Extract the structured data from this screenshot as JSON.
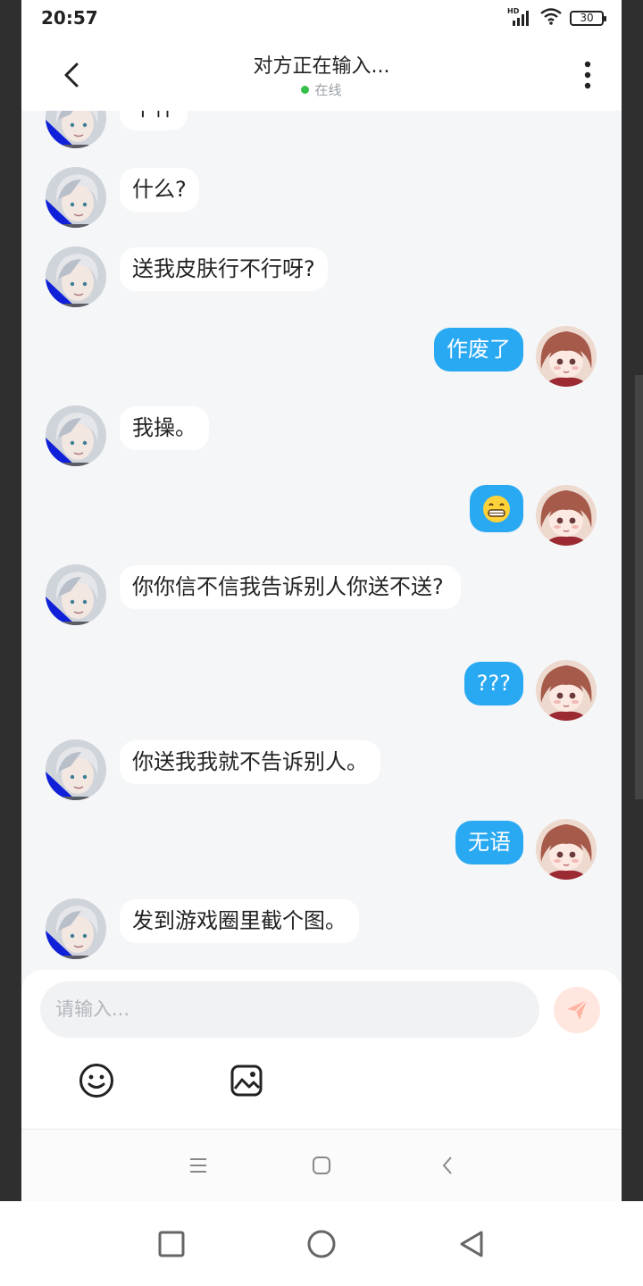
{
  "status_bar": {
    "time": "20:57",
    "network": "HD",
    "battery": "30"
  },
  "header": {
    "title": "对方正在输入...",
    "presence": "在线"
  },
  "messages": [
    {
      "side": "in",
      "text": "干什"
    },
    {
      "side": "in",
      "text": "什么?"
    },
    {
      "side": "in",
      "text": "送我皮肤行不行呀?"
    },
    {
      "side": "out",
      "text": "作废了"
    },
    {
      "side": "in",
      "text": "我操。"
    },
    {
      "side": "out",
      "text": "😁"
    },
    {
      "side": "in",
      "text": "你你信不信我告诉别人你送不送?"
    },
    {
      "side": "out",
      "text": "???"
    },
    {
      "side": "in",
      "text": "你送我我就不告诉别人。"
    },
    {
      "side": "out",
      "text": "无语"
    },
    {
      "side": "in",
      "text": "发到游戏圈里截个图。"
    }
  ],
  "composer": {
    "placeholder": "请输入..."
  },
  "colors": {
    "outgoing_bubble": "#2aa9f3",
    "incoming_bubble": "#ffffff",
    "online_dot": "#35c04a",
    "send_button": "#ffe6df"
  },
  "icons": [
    "back-icon",
    "more-vertical-icon",
    "send-icon",
    "smile-icon",
    "image-icon",
    "menu-icon",
    "home-square-icon",
    "chevron-left-icon",
    "recents-icon",
    "home-circle-icon",
    "back-triangle-icon"
  ]
}
